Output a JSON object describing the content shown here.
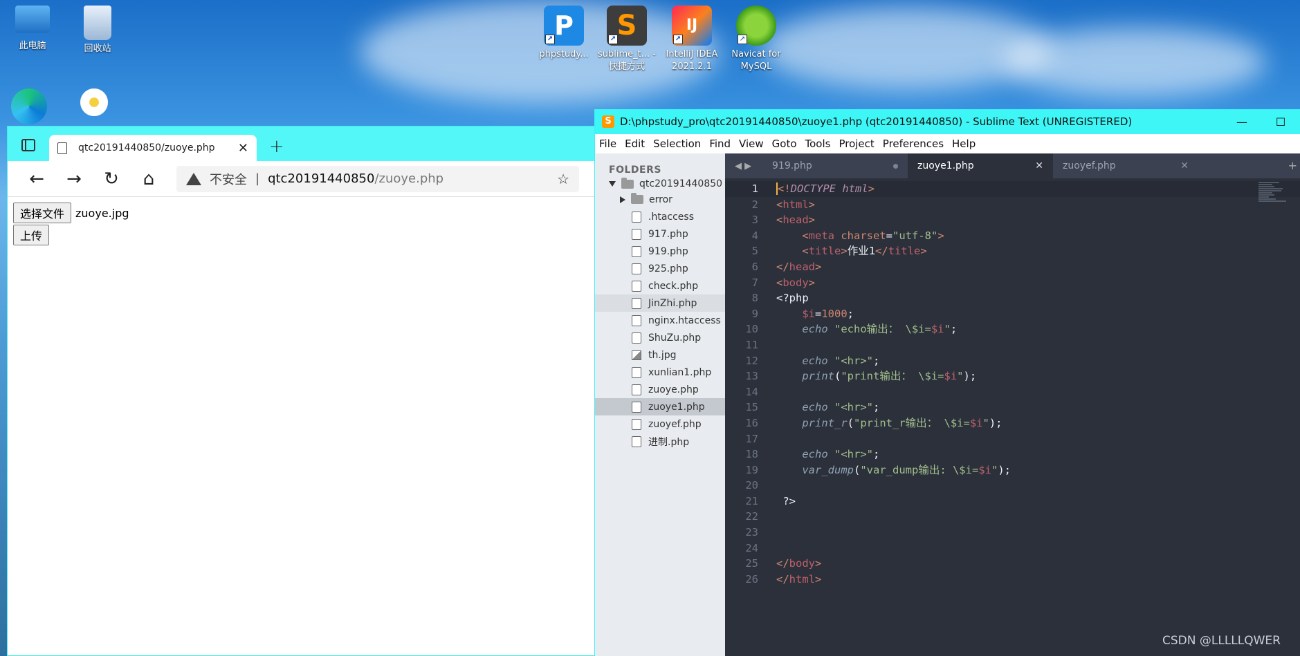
{
  "desktop": {
    "icons": [
      {
        "label": "此电脑",
        "icon": "computer-icon"
      },
      {
        "label": "回收站",
        "icon": "recycle-bin-icon"
      },
      {
        "label": "phpstudy...",
        "icon": "phpstudy-icon"
      },
      {
        "label": "sublime_t... - 快捷方式",
        "icon": "sublime-text-icon"
      },
      {
        "label": "IntelliJ IDEA 2021.2.1",
        "icon": "intellij-idea-icon"
      },
      {
        "label": "Navicat for MySQL",
        "icon": "navicat-icon"
      }
    ]
  },
  "browser": {
    "tab_title": "qtc20191440850/zuoye.php",
    "address": {
      "security": "不安全",
      "host": "qtc20191440850",
      "path": "/zuoye.php"
    },
    "page": {
      "choose_file_label": "选择文件",
      "chosen_file": "zuoye.jpg",
      "upload_label": "上传"
    }
  },
  "sublime": {
    "window_title": "D:\\phpstudy_pro\\qtc20191440850\\zuoye1.php (qtc20191440850) - Sublime Text (UNREGISTERED)",
    "menu": [
      "File",
      "Edit",
      "Selection",
      "Find",
      "View",
      "Goto",
      "Tools",
      "Project",
      "Preferences",
      "Help"
    ],
    "sidebar": {
      "heading": "FOLDERS",
      "root": "qtc20191440850",
      "items": [
        {
          "name": "error",
          "type": "folder"
        },
        {
          "name": ".htaccess",
          "type": "file"
        },
        {
          "name": "917.php",
          "type": "file"
        },
        {
          "name": "919.php",
          "type": "file"
        },
        {
          "name": "925.php",
          "type": "file"
        },
        {
          "name": "check.php",
          "type": "file"
        },
        {
          "name": "JinZhi.php",
          "type": "file",
          "state": "hover"
        },
        {
          "name": "nginx.htaccess",
          "type": "file"
        },
        {
          "name": "ShuZu.php",
          "type": "file"
        },
        {
          "name": "th.jpg",
          "type": "image"
        },
        {
          "name": "xunlian1.php",
          "type": "file"
        },
        {
          "name": "zuoye.php",
          "type": "file"
        },
        {
          "name": "zuoye1.php",
          "type": "file",
          "state": "active"
        },
        {
          "name": "zuoyef.php",
          "type": "file"
        },
        {
          "name": "进制.php",
          "type": "file"
        }
      ]
    },
    "tabs": [
      {
        "label": "919.php",
        "state": "dirty"
      },
      {
        "label": "zuoye1.php",
        "state": "active"
      },
      {
        "label": "zuoyef.php",
        "state": "normal"
      }
    ],
    "code_lines": [
      [
        {
          "t": "<!",
          "c": "t-punc"
        },
        {
          "t": "DOCTYPE",
          "c": "t-kw"
        },
        {
          "t": " ",
          "c": "t-plain"
        },
        {
          "t": "html",
          "c": "t-kw"
        },
        {
          "t": ">",
          "c": "t-punc"
        }
      ],
      [
        {
          "t": "<",
          "c": "t-punc"
        },
        {
          "t": "html",
          "c": "t-tag"
        },
        {
          "t": ">",
          "c": "t-punc"
        }
      ],
      [
        {
          "t": "<",
          "c": "t-punc"
        },
        {
          "t": "head",
          "c": "t-tag"
        },
        {
          "t": ">",
          "c": "t-punc"
        }
      ],
      [
        {
          "t": "    <",
          "c": "t-punc"
        },
        {
          "t": "meta",
          "c": "t-tag"
        },
        {
          "t": " charset",
          "c": "t-attr"
        },
        {
          "t": "=",
          "c": "t-plain"
        },
        {
          "t": "\"utf-8\"",
          "c": "t-str"
        },
        {
          "t": ">",
          "c": "t-punc"
        }
      ],
      [
        {
          "t": "    <",
          "c": "t-punc"
        },
        {
          "t": "title",
          "c": "t-tag"
        },
        {
          "t": ">",
          "c": "t-punc"
        },
        {
          "t": "作业1",
          "c": "t-plain"
        },
        {
          "t": "</",
          "c": "t-punc"
        },
        {
          "t": "title",
          "c": "t-tag"
        },
        {
          "t": ">",
          "c": "t-punc"
        }
      ],
      [
        {
          "t": "</",
          "c": "t-punc"
        },
        {
          "t": "head",
          "c": "t-tag"
        },
        {
          "t": ">",
          "c": "t-punc"
        }
      ],
      [
        {
          "t": "<",
          "c": "t-punc"
        },
        {
          "t": "body",
          "c": "t-tag"
        },
        {
          "t": ">",
          "c": "t-punc"
        }
      ],
      [
        {
          "t": "<?php",
          "c": "t-plain"
        }
      ],
      [
        {
          "t": "    $i",
          "c": "t-var"
        },
        {
          "t": "=",
          "c": "t-plain"
        },
        {
          "t": "1000",
          "c": "t-num"
        },
        {
          "t": ";",
          "c": "t-plain"
        }
      ],
      [
        {
          "t": "    echo",
          "c": "t-fn"
        },
        {
          "t": " ",
          "c": "t-plain"
        },
        {
          "t": "\"echo输出： \\$i=",
          "c": "t-str"
        },
        {
          "t": "$i",
          "c": "t-var"
        },
        {
          "t": "\"",
          "c": "t-str"
        },
        {
          "t": ";",
          "c": "t-plain"
        }
      ],
      [
        {
          "t": "",
          "c": "t-plain"
        }
      ],
      [
        {
          "t": "    echo",
          "c": "t-fn"
        },
        {
          "t": " ",
          "c": "t-plain"
        },
        {
          "t": "\"<hr>\"",
          "c": "t-str"
        },
        {
          "t": ";",
          "c": "t-plain"
        }
      ],
      [
        {
          "t": "    print",
          "c": "t-fn"
        },
        {
          "t": "(",
          "c": "t-plain"
        },
        {
          "t": "\"print输出： \\$i=",
          "c": "t-str"
        },
        {
          "t": "$i",
          "c": "t-var"
        },
        {
          "t": "\"",
          "c": "t-str"
        },
        {
          "t": ");",
          "c": "t-plain"
        }
      ],
      [
        {
          "t": "",
          "c": "t-plain"
        }
      ],
      [
        {
          "t": "    echo",
          "c": "t-fn"
        },
        {
          "t": " ",
          "c": "t-plain"
        },
        {
          "t": "\"<hr>\"",
          "c": "t-str"
        },
        {
          "t": ";",
          "c": "t-plain"
        }
      ],
      [
        {
          "t": "    print_r",
          "c": "t-fn"
        },
        {
          "t": "(",
          "c": "t-plain"
        },
        {
          "t": "\"print_r输出： \\$i=",
          "c": "t-str"
        },
        {
          "t": "$i",
          "c": "t-var"
        },
        {
          "t": "\"",
          "c": "t-str"
        },
        {
          "t": ");",
          "c": "t-plain"
        }
      ],
      [
        {
          "t": "",
          "c": "t-plain"
        }
      ],
      [
        {
          "t": "    echo",
          "c": "t-fn"
        },
        {
          "t": " ",
          "c": "t-plain"
        },
        {
          "t": "\"<hr>\"",
          "c": "t-str"
        },
        {
          "t": ";",
          "c": "t-plain"
        }
      ],
      [
        {
          "t": "    var_dump",
          "c": "t-fn"
        },
        {
          "t": "(",
          "c": "t-plain"
        },
        {
          "t": "\"var_dump输出: \\$i=",
          "c": "t-str"
        },
        {
          "t": "$i",
          "c": "t-var"
        },
        {
          "t": "\"",
          "c": "t-str"
        },
        {
          "t": ");",
          "c": "t-plain"
        }
      ],
      [
        {
          "t": "",
          "c": "t-plain"
        }
      ],
      [
        {
          "t": " ?>",
          "c": "t-plain"
        }
      ],
      [
        {
          "t": "",
          "c": "t-plain"
        }
      ],
      [
        {
          "t": "",
          "c": "t-plain"
        }
      ],
      [
        {
          "t": "",
          "c": "t-plain"
        }
      ],
      [
        {
          "t": "</",
          "c": "t-punc"
        },
        {
          "t": "body",
          "c": "t-tag"
        },
        {
          "t": ">",
          "c": "t-punc"
        }
      ],
      [
        {
          "t": "</",
          "c": "t-punc"
        },
        {
          "t": "html",
          "c": "t-tag"
        },
        {
          "t": ">",
          "c": "t-punc"
        }
      ]
    ],
    "current_line": 1,
    "watermark": "CSDN @LLLLLQWER"
  },
  "colors": {
    "window_accent": "#3ff6f6",
    "editor_bg": "#2b303b",
    "sidebar_bg": "#e8ebef"
  }
}
